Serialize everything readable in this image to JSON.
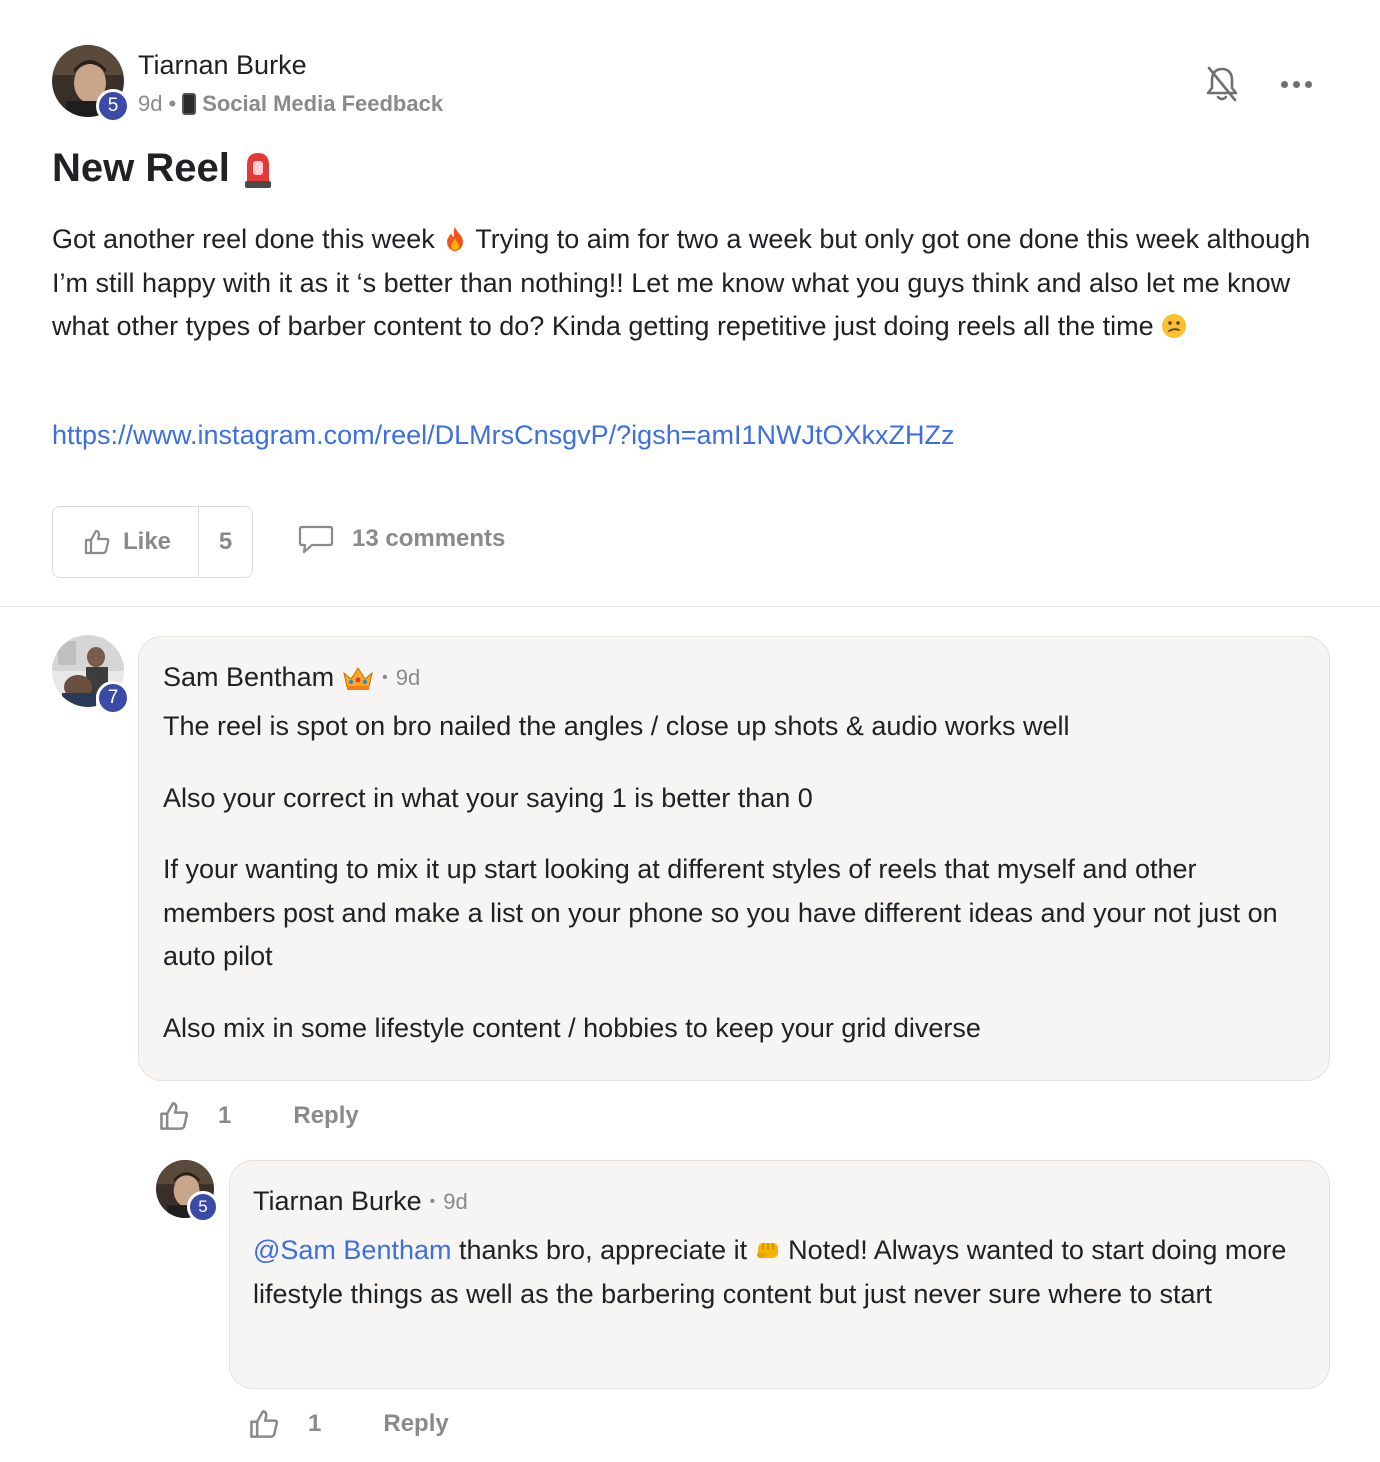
{
  "post": {
    "author": "Tiarnan Burke",
    "author_level": "5",
    "age": "9d",
    "separator": "•",
    "category": "Social Media Feedback",
    "title": "New Reel",
    "body_part1": "Got another reel done this week ",
    "body_part2": " Trying to aim for two a week but only got one done this week although I’m still happy with it as it ‘s better than nothing!! Let me know what you guys think and also let me know what other types of barber content to do? Kinda getting repetitive just doing reels all the time ",
    "link": "https://www.instagram.com/reel/DLMrsCnsgvP/?igsh=amI1NWJtOXkxZHZz",
    "like_label": "Like",
    "like_count": "5",
    "comments_label": "13 comments"
  },
  "comments": [
    {
      "author": "Sam Bentham",
      "author_level": "7",
      "separator": "•",
      "age": "9d",
      "paragraphs": [
        "The reel is spot on bro nailed the angles / close up shots & audio works well",
        "Also your correct in what your saying 1 is better than 0",
        "If your wanting to mix it up start looking at different styles of reels that myself and other members post and make a list on your phone so you have different ideas and your not just on auto pilot",
        "Also mix in some lifestyle content / hobbies to keep your grid diverse"
      ],
      "like_count": "1",
      "reply_label": "Reply"
    },
    {
      "author": "Tiarnan Burke",
      "author_level": "5",
      "separator": "•",
      "age": "9d",
      "mention": "@Sam Bentham",
      "text_part1": " thanks bro, appreciate it ",
      "text_part2": " Noted! Always wanted to start doing more lifestyle things as well as the barbering content but just never sure where to start",
      "like_count": "1",
      "reply_label": "Reply"
    }
  ],
  "icons": {
    "bell": "bell-off-icon",
    "more": "more-horizontal-icon",
    "phone": "mobile-phone-icon",
    "siren": "police-light-emoji",
    "fire": "fire-emoji",
    "confused": "confused-face-emoji",
    "crown": "crown-emoji",
    "fist": "oncoming-fist-emoji",
    "like": "thumbs-up-icon",
    "comment": "speech-bubble-icon"
  },
  "colors": {
    "level_badge": "#3b4aa6",
    "link": "#3d6fe0",
    "bubble": "#f6f5f3",
    "muted": "#8a8a8a"
  }
}
